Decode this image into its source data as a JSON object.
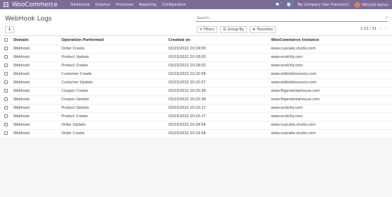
{
  "topbar": {
    "brand": "WooCommerce",
    "menu": [
      "Dashboard",
      "Instance",
      "Processes",
      "Reporting",
      "Configuration"
    ],
    "chat_count": "5",
    "activity_count": "5",
    "company": "My Company (San Francisco)",
    "user": "Mitchell Admin"
  },
  "control": {
    "title": "WebHook Logs",
    "search_placeholder": "Search...",
    "filters": "Filters",
    "group_by": "Group By",
    "favorites": "Favorites",
    "pager": "1-11 / 11"
  },
  "table": {
    "headers": [
      "Domain",
      "Operation Performed",
      "Created on",
      "WooCommerce Instance"
    ],
    "rows": [
      [
        "Webhook",
        "Order Create",
        "03/23/2022 20:29:50",
        "www.cupcake.studio.com"
      ],
      [
        "Webhook",
        "Product Update",
        "03/23/2022 20:28:03",
        "www.ecokitty.com"
      ],
      [
        "Webhook",
        "Product Create",
        "03/23/2022 20:28:02",
        "www.ecokitty.com"
      ],
      [
        "Webhook",
        "Customer Create",
        "03/23/2022 20:25:58",
        "www.edibleblossoms.com"
      ],
      [
        "Webhook",
        "Customer Update",
        "03/23/2022 20:25:57",
        "www.edibleblossoms.com"
      ],
      [
        "Webhook",
        "Coupon Create",
        "03/23/2022 20:25:38",
        "www.fitgersbrewhouse.com"
      ],
      [
        "Webhook",
        "Coupon Update",
        "03/23/2022 20:25:38",
        "www.fitgersbrewhouse.com"
      ],
      [
        "Webhook",
        "Product Update",
        "03/23/2022 20:25:17",
        "www.ecokitty.com"
      ],
      [
        "Webhook",
        "Product Create",
        "03/23/2022 20:25:17",
        "www.ecokitty.com"
      ],
      [
        "Webhook",
        "Order Update",
        "03/23/2022 20:24:54",
        "www.cupcake.studio.com"
      ],
      [
        "Webhook",
        "Order Create",
        "03/23/2022 20:24:54",
        "www.cupcake.studio.com"
      ]
    ]
  }
}
